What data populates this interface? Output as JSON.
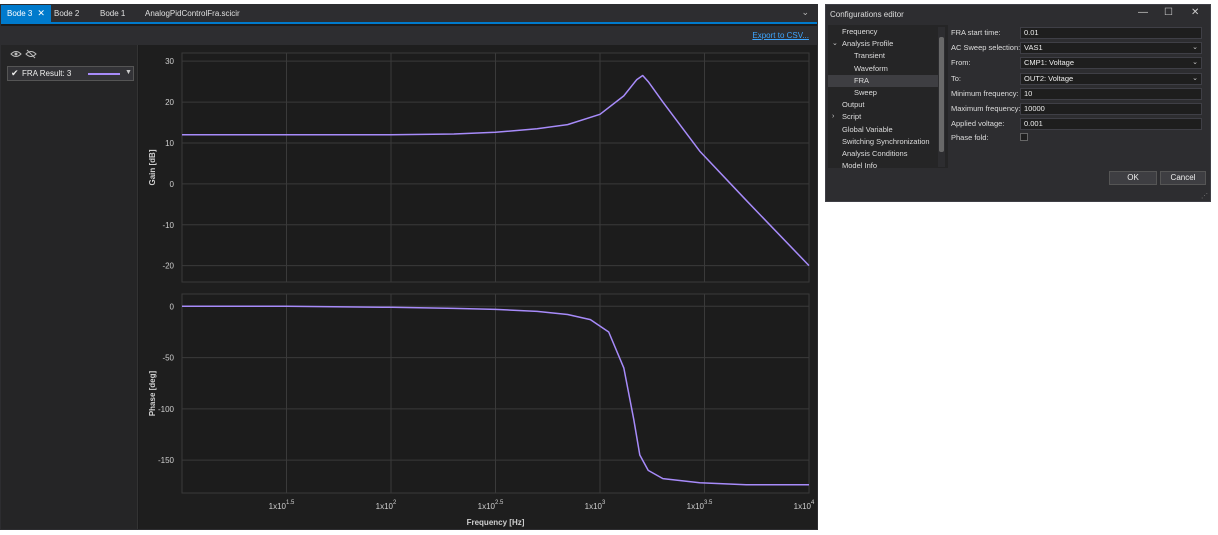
{
  "main_window": {
    "tabs": [
      {
        "label": "Bode 3",
        "active": true,
        "closable": true
      },
      {
        "label": "Bode 2",
        "active": false
      },
      {
        "label": "Bode 1",
        "active": false
      },
      {
        "label": "AnalogPidControlFra.scicir",
        "active": false
      }
    ],
    "export_link": "Export to CSV...",
    "result_item": {
      "label": "FRA Result: 3",
      "checked": true,
      "line_color": "#a78bfa"
    }
  },
  "chart_data": [
    {
      "type": "line",
      "title": "",
      "xlabel": "",
      "ylabel": "Gain [dB]",
      "xscale": "log",
      "xlim": [
        10,
        10000
      ],
      "ylim": [
        -24,
        32
      ],
      "yticks": [
        30,
        20,
        10,
        0,
        -10,
        -20
      ],
      "grid": true,
      "series": [
        {
          "color": "#a78bfa",
          "x": [
            10,
            31.6,
            100,
            200,
            316,
            500,
            700,
            1000,
            1300,
            1500,
            1600,
            1700,
            2000,
            3000,
            5000,
            10000
          ],
          "values": [
            12,
            12,
            12,
            12.2,
            12.6,
            13.5,
            14.5,
            17,
            21.5,
            25.5,
            26.5,
            25,
            20,
            8,
            -4,
            -20
          ]
        }
      ]
    },
    {
      "type": "line",
      "title": "",
      "xlabel": "Frequency [Hz]",
      "ylabel": "Phase [deg]",
      "xscale": "log",
      "xlim": [
        10,
        10000
      ],
      "ylim": [
        -182,
        12
      ],
      "yticks": [
        0,
        -50,
        -100,
        -150
      ],
      "xticks": [
        "1x10^1.5",
        "1x10^2",
        "1x10^2.5",
        "1x10^3",
        "1x10^3.5",
        "1x10^4"
      ],
      "grid": true,
      "series": [
        {
          "color": "#a78bfa",
          "x": [
            10,
            31.6,
            100,
            200,
            316,
            500,
            700,
            900,
            1100,
            1300,
            1450,
            1550,
            1700,
            2000,
            3000,
            5000,
            10000
          ],
          "values": [
            0,
            0,
            -1,
            -2,
            -3,
            -5,
            -8,
            -13,
            -25,
            -60,
            -110,
            -145,
            -160,
            -168,
            -172,
            -174,
            -174
          ]
        }
      ]
    }
  ],
  "config_editor": {
    "title": "Configurations editor",
    "window_buttons": {
      "minimize": "—",
      "maximize": "☐",
      "close": "✕"
    },
    "tree": [
      {
        "label": "Frequency",
        "indent": 0,
        "caret": ""
      },
      {
        "label": "Analysis Profile",
        "indent": 0,
        "caret": "⌄"
      },
      {
        "label": "Transient",
        "indent": 1,
        "caret": ""
      },
      {
        "label": "Waveform",
        "indent": 1,
        "caret": ""
      },
      {
        "label": "FRA",
        "indent": 1,
        "caret": "",
        "selected": true
      },
      {
        "label": "Sweep",
        "indent": 1,
        "caret": ""
      },
      {
        "label": "Output",
        "indent": 0,
        "caret": ""
      },
      {
        "label": "Script",
        "indent": 0,
        "caret": "›"
      },
      {
        "label": "Global Variable",
        "indent": 0,
        "caret": ""
      },
      {
        "label": "Switching Synchronization",
        "indent": 0,
        "caret": ""
      },
      {
        "label": "Analysis Conditions",
        "indent": 0,
        "caret": ""
      },
      {
        "label": "Model Info",
        "indent": 0,
        "caret": ""
      }
    ],
    "properties": [
      {
        "label": "FRA start time:",
        "value": "0.01",
        "dropdown": false
      },
      {
        "label": "AC Sweep selection:",
        "value": "VAS1",
        "dropdown": true
      },
      {
        "label": "From:",
        "value": "CMP1: Voltage",
        "dropdown": true
      },
      {
        "label": "To:",
        "value": "OUT2: Voltage",
        "dropdown": true
      },
      {
        "label": "Minimum frequency:",
        "value": "10",
        "dropdown": false
      },
      {
        "label": "Maximum frequency:",
        "value": "10000",
        "dropdown": false
      },
      {
        "label": "Applied voltage:",
        "value": "0.001",
        "dropdown": false
      }
    ],
    "phase_fold": {
      "label": "Phase fold:",
      "checked": false
    },
    "ok_label": "OK",
    "cancel_label": "Cancel"
  }
}
